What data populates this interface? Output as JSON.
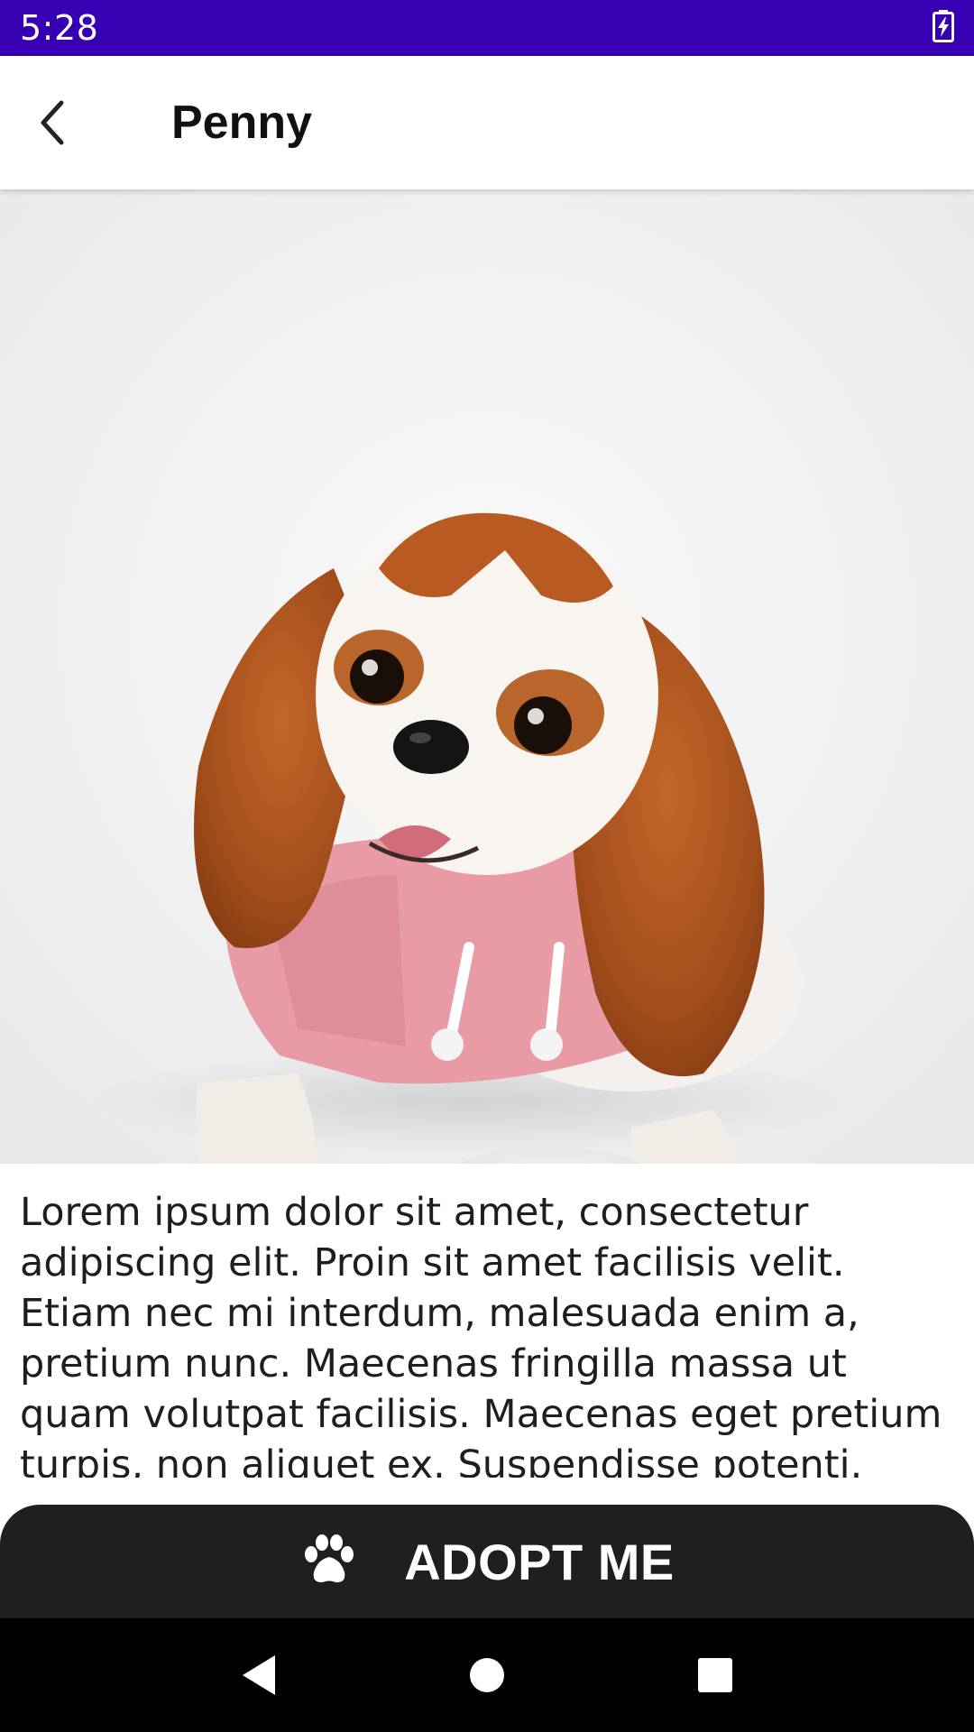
{
  "status_bar": {
    "time": "5:28",
    "icons": [
      "battery-charging-icon"
    ],
    "background": "#3700B3"
  },
  "app_bar": {
    "title": "Penny",
    "back_icon": "back-arrow-icon"
  },
  "hero_image": {
    "subject": "pet-photo",
    "alt": "Penny"
  },
  "description": {
    "text": "Lorem ipsum dolor sit amet, consectetur adipiscing elit. Proin sit amet facilisis velit. Etiam nec mi interdum, malesuada enim a, pretium nunc. Maecenas fringilla massa ut quam volutpat facilisis. Maecenas eget pretium turpis, non aliquet ex. Suspendisse potenti. Suspendisse"
  },
  "adopt_button": {
    "label": "ADOPT ME",
    "icon": "paw-icon",
    "background": "#1f1f1f"
  },
  "nav_bar": {
    "buttons": [
      "back-triangle-icon",
      "home-circle-icon",
      "recents-square-icon"
    ]
  }
}
